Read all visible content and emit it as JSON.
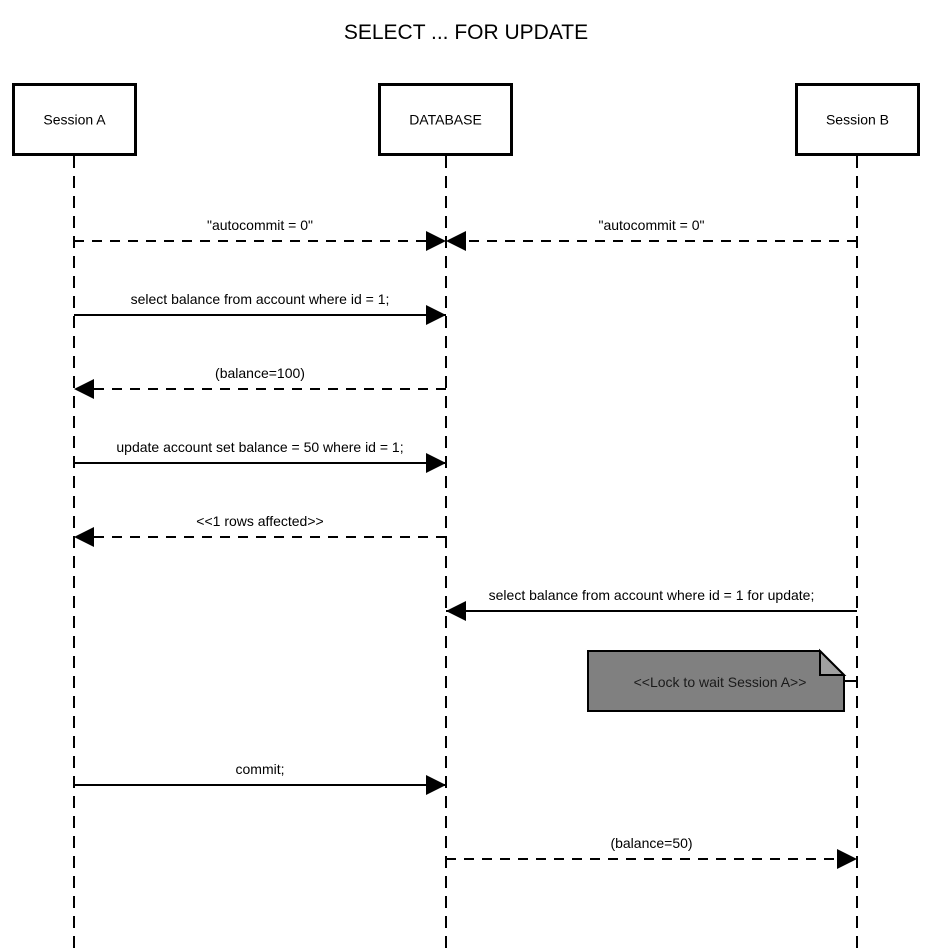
{
  "title": "SELECT ... FOR UPDATE",
  "colors": {
    "line": "#000000",
    "note_fill": "#808080",
    "note_fold": "#a0a0a0",
    "background": "#ffffff"
  },
  "actors": [
    {
      "id": "A",
      "label": "Session A"
    },
    {
      "id": "DB",
      "label": "DATABASE"
    },
    {
      "id": "B",
      "label": "Session B"
    }
  ],
  "messages": [
    {
      "from": "A",
      "to": "DB",
      "label": "\"autocommit = 0\"",
      "style": "dashed"
    },
    {
      "from": "B",
      "to": "DB",
      "label": "\"autocommit = 0\"",
      "style": "dashed"
    },
    {
      "from": "A",
      "to": "DB",
      "label": "select balance from account where id = 1;",
      "style": "solid"
    },
    {
      "from": "DB",
      "to": "A",
      "label": "(balance=100)",
      "style": "dashed"
    },
    {
      "from": "A",
      "to": "DB",
      "label": "update account set balance = 50 where id = 1;",
      "style": "solid"
    },
    {
      "from": "DB",
      "to": "A",
      "label": "<<1 rows affected>>",
      "style": "dashed"
    },
    {
      "from": "B",
      "to": "DB",
      "label": "select balance from account where id = 1 for update;",
      "style": "solid"
    },
    {
      "from": "A",
      "to": "DB",
      "label": "commit;",
      "style": "solid"
    },
    {
      "from": "DB",
      "to": "B",
      "label": "(balance=50)",
      "style": "dashed"
    }
  ],
  "note": {
    "attached_to": "B",
    "label": "<<Lock to wait Session A>>"
  }
}
